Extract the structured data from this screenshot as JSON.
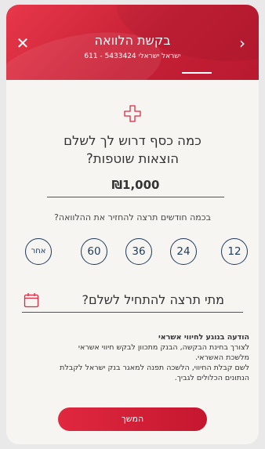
{
  "header": {
    "title": "בקשת הלוואה",
    "subtitle": "ישראל ישראלי 5433424 - 611",
    "close_icon": "close-icon",
    "back_icon": "chevron-right-icon",
    "accent_color": "#d42a3e"
  },
  "main": {
    "icon": "plus-outline-icon",
    "question_line1": "כמה כסף דרוש לך לשלם",
    "question_line2": "הוצאות שוטפות?",
    "amount_value": "₪1,000",
    "months_label": "בכמה חודשים תרצה להחזיר את ההלוואה?",
    "month_options": [
      "12",
      "24",
      "36",
      "60",
      "אחר"
    ],
    "date_label": "מתי תרצה להתחיל לשלם?",
    "calendar_icon": "calendar-icon"
  },
  "notice": {
    "title": "הודעה בנוגע לחיווי אשראי",
    "line1": "לצורך בחינת הבקשה, הבנק מתכוון לבקש חיווי אשראי",
    "line2": "מלשכת האשראי.",
    "line3": "לשם קבלת החיווי, הלשכה תפנה למאגר בנק ישראל לקבלת",
    "line4": "הנתונים הכלולים לגביך."
  },
  "footer": {
    "continue_label": "המשך"
  }
}
